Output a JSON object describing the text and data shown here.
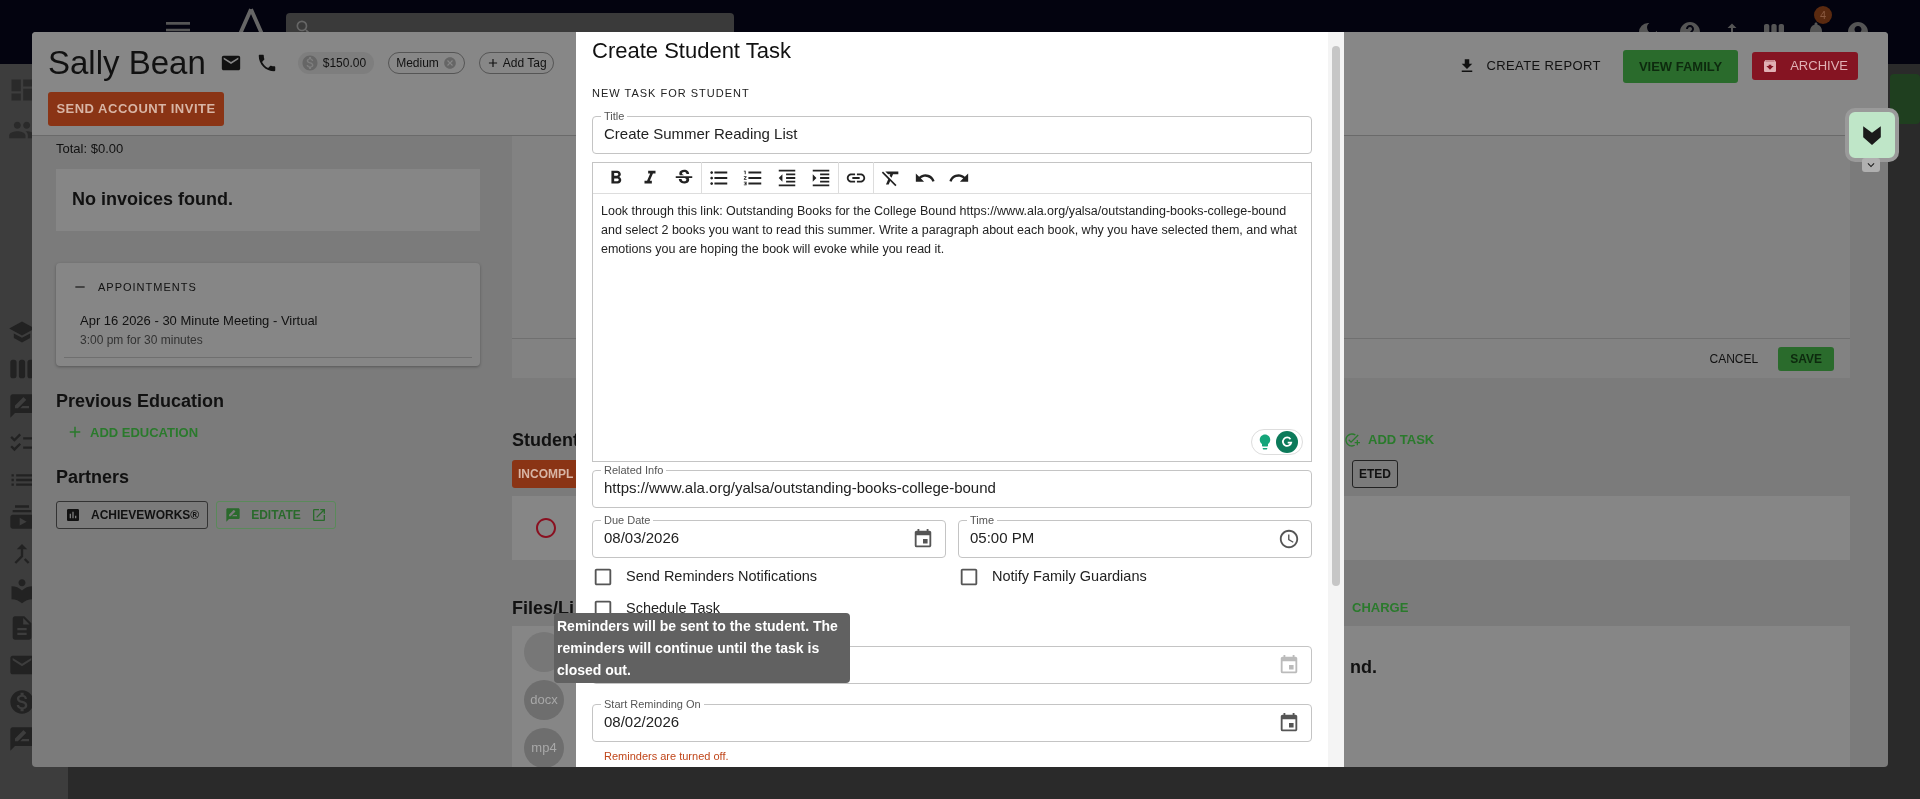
{
  "app_bar": {
    "notification_count": "4"
  },
  "profile": {
    "name": "Sally Bean",
    "balance": "$150.00",
    "tags": [
      {
        "label": "Medium"
      }
    ],
    "add_tag": "Add Tag",
    "invite_button": "SEND ACCOUNT INVITE",
    "create_report": "CREATE REPORT",
    "view_family": "VIEW FAMILY",
    "archive": "ARCHIVE"
  },
  "invoices": {
    "total": "Total: $0.00",
    "empty": "No invoices found."
  },
  "appointments": {
    "heading": "APPOINTMENTS",
    "items": [
      {
        "title": "Apr 16 2026 - 30 Minute Meeting - Virtual",
        "detail": "3:00 pm for 30 minutes"
      }
    ]
  },
  "previous_education": {
    "heading": "Previous Education",
    "add": "ADD EDUCATION"
  },
  "partners": {
    "heading": "Partners",
    "items": [
      {
        "label": "ACHIEVEWORKS®",
        "kind": "chart"
      },
      {
        "label": "EDITATE",
        "kind": "external"
      }
    ]
  },
  "editor_card": {
    "cancel": "CANCEL",
    "save": "SAVE"
  },
  "tasks": {
    "heading": "Student",
    "add": "ADD TASK",
    "filters": [
      {
        "label": "INCOMPL",
        "selected": true
      },
      {
        "label": "ETED",
        "selected": false
      }
    ]
  },
  "files": {
    "heading": "Files/Li",
    "action": "CHARGE",
    "empty": "nd.",
    "items": [
      {
        "label": "docx"
      },
      {
        "label": "mp4"
      }
    ]
  },
  "modal": {
    "title": "Create Student Task",
    "section": "NEW TASK FOR STUDENT",
    "title_field": {
      "label": "Title",
      "value": "Create Summer Reading List"
    },
    "description": "Look through this link: Outstanding Books for the College Bound https://www.ala.org/yalsa/outstanding-books-college-bound and select 2 books you want to read this summer. Write a paragraph about each book, why you have selected them, and what emotions you are hoping the book will evoke while you read it.",
    "related_info": {
      "label": "Related Info",
      "value": "https://www.ala.org/yalsa/outstanding-books-college-bound"
    },
    "due_date": {
      "label": "Due Date",
      "value": "08/03/2026"
    },
    "time": {
      "label": "Time",
      "value": "05:00 PM"
    },
    "checkboxes": [
      {
        "label": "Send Reminders Notifications",
        "checked": false
      },
      {
        "label": "Notify Family Guardians",
        "checked": false
      },
      {
        "label": "Schedule Task",
        "checked": false
      }
    ],
    "start_reminding": {
      "label": "Start Reminding On",
      "value": "08/02/2026"
    },
    "reminder_note": "Reminders are turned off."
  },
  "tooltip": "Reminders will be sent to the student. The reminders will continue until the task is closed out."
}
